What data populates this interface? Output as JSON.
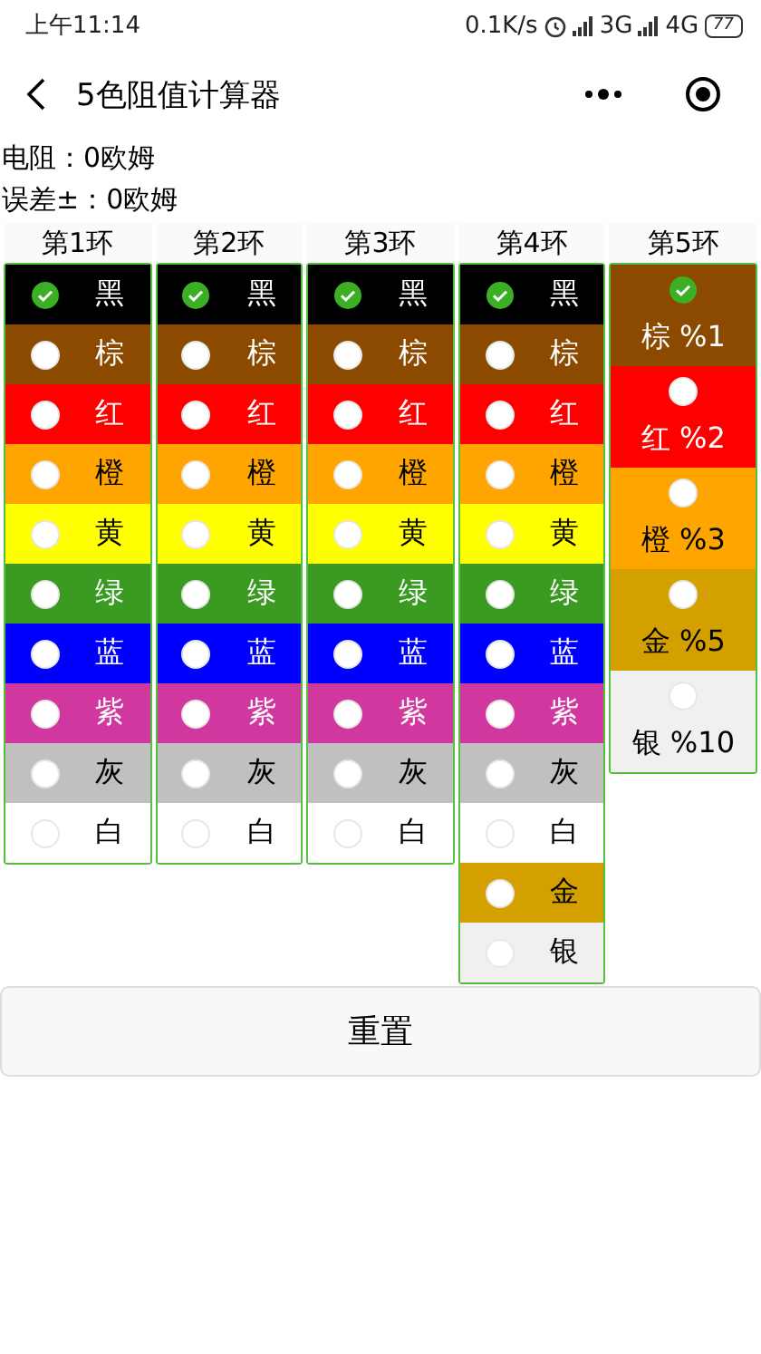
{
  "status_bar": {
    "time": "上午11:14",
    "speed": "0.1K/s",
    "network_1": "3G",
    "network_2": "4G",
    "battery": "77"
  },
  "nav": {
    "title": "5色阻值计算器"
  },
  "results": [
    "电阻：0欧姆",
    "误差±：0欧姆"
  ],
  "bands": [
    {
      "title": "第1环",
      "kind": "digit",
      "options": [
        {
          "label": "黑",
          "color": "#000000",
          "selected": true
        },
        {
          "label": "棕",
          "color": "#8b4a00",
          "selected": false
        },
        {
          "label": "红",
          "color": "#ff0000",
          "selected": false
        },
        {
          "label": "橙",
          "color": "#ffa500",
          "selected": false
        },
        {
          "label": "黄",
          "color": "#ffff00",
          "selected": false
        },
        {
          "label": "绿",
          "color": "#3a9a22",
          "selected": false
        },
        {
          "label": "蓝",
          "color": "#0000ff",
          "selected": false
        },
        {
          "label": "紫",
          "color": "#d038a0",
          "selected": false
        },
        {
          "label": "灰",
          "color": "#c0c0c0",
          "selected": false
        },
        {
          "label": "白",
          "color": "#ffffff",
          "selected": false
        }
      ]
    },
    {
      "title": "第2环",
      "kind": "digit",
      "options": [
        {
          "label": "黑",
          "color": "#000000",
          "selected": true
        },
        {
          "label": "棕",
          "color": "#8b4a00",
          "selected": false
        },
        {
          "label": "红",
          "color": "#ff0000",
          "selected": false
        },
        {
          "label": "橙",
          "color": "#ffa500",
          "selected": false
        },
        {
          "label": "黄",
          "color": "#ffff00",
          "selected": false
        },
        {
          "label": "绿",
          "color": "#3a9a22",
          "selected": false
        },
        {
          "label": "蓝",
          "color": "#0000ff",
          "selected": false
        },
        {
          "label": "紫",
          "color": "#d038a0",
          "selected": false
        },
        {
          "label": "灰",
          "color": "#c0c0c0",
          "selected": false
        },
        {
          "label": "白",
          "color": "#ffffff",
          "selected": false
        }
      ]
    },
    {
      "title": "第3环",
      "kind": "digit",
      "options": [
        {
          "label": "黑",
          "color": "#000000",
          "selected": true
        },
        {
          "label": "棕",
          "color": "#8b4a00",
          "selected": false
        },
        {
          "label": "红",
          "color": "#ff0000",
          "selected": false
        },
        {
          "label": "橙",
          "color": "#ffa500",
          "selected": false
        },
        {
          "label": "黄",
          "color": "#ffff00",
          "selected": false
        },
        {
          "label": "绿",
          "color": "#3a9a22",
          "selected": false
        },
        {
          "label": "蓝",
          "color": "#0000ff",
          "selected": false
        },
        {
          "label": "紫",
          "color": "#d038a0",
          "selected": false
        },
        {
          "label": "灰",
          "color": "#c0c0c0",
          "selected": false
        },
        {
          "label": "白",
          "color": "#ffffff",
          "selected": false
        }
      ]
    },
    {
      "title": "第4环",
      "kind": "digit",
      "options": [
        {
          "label": "黑",
          "color": "#000000",
          "selected": true
        },
        {
          "label": "棕",
          "color": "#8b4a00",
          "selected": false
        },
        {
          "label": "红",
          "color": "#ff0000",
          "selected": false
        },
        {
          "label": "橙",
          "color": "#ffa500",
          "selected": false
        },
        {
          "label": "黄",
          "color": "#ffff00",
          "selected": false
        },
        {
          "label": "绿",
          "color": "#3a9a22",
          "selected": false
        },
        {
          "label": "蓝",
          "color": "#0000ff",
          "selected": false
        },
        {
          "label": "紫",
          "color": "#d038a0",
          "selected": false
        },
        {
          "label": "灰",
          "color": "#c0c0c0",
          "selected": false
        },
        {
          "label": "白",
          "color": "#ffffff",
          "selected": false
        },
        {
          "label": "金",
          "color": "#d4a000",
          "selected": false
        },
        {
          "label": "银",
          "color": "#f0f0f0",
          "selected": false
        }
      ]
    },
    {
      "title": "第5环",
      "kind": "tolerance",
      "options": [
        {
          "label": "棕 %1",
          "color": "#8b4a00",
          "selected": true
        },
        {
          "label": "红 %2",
          "color": "#ff0000",
          "selected": false
        },
        {
          "label": "橙 %3",
          "color": "#ffa500",
          "selected": false
        },
        {
          "label": "金 %5",
          "color": "#d4a000",
          "selected": false
        },
        {
          "label": "银 %10",
          "color": "#f0f0f0",
          "selected": false
        }
      ]
    }
  ],
  "reset_button": "重置"
}
